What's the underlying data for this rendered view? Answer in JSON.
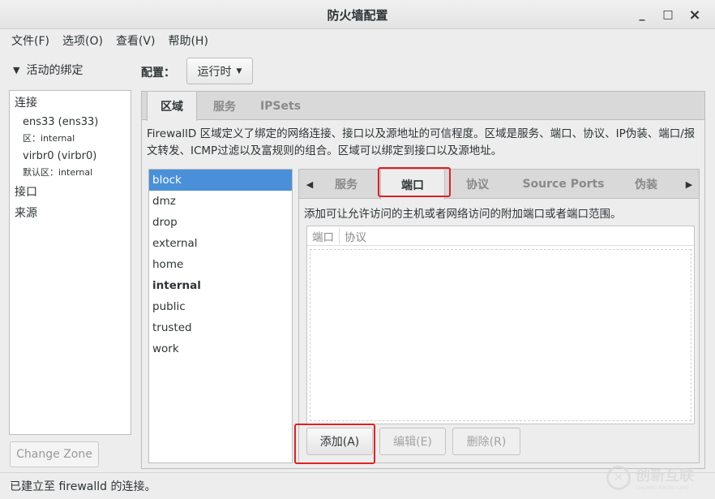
{
  "window": {
    "title": "防火墙配置",
    "minimize": "_",
    "maximize": "□",
    "close": "×"
  },
  "menu": [
    "文件(F)",
    "选项(O)",
    "查看(V)",
    "帮助(H)"
  ],
  "bindings": {
    "header": "活动的绑定",
    "connections_label": "连接",
    "connections": [
      {
        "name": "ens33 (ens33)",
        "zone": "区：internal"
      },
      {
        "name": "virbr0 (virbr0)",
        "zone": "默认区：internal"
      }
    ],
    "interfaces_label": "接口",
    "sources_label": "来源",
    "change_zone": "Change Zone"
  },
  "config": {
    "label": "配置：",
    "mode": "运行时"
  },
  "main_tabs": [
    "区域",
    "服务",
    "IPSets"
  ],
  "main_tab_active": 0,
  "zone_description": "FirewallD 区域定义了绑定的网络连接、接口以及源地址的可信程度。区域是服务、端口、协议、IP伪装、端口/报文转发、ICMP过滤以及富规则的组合。区域可以绑定到接口以及源地址。",
  "zones": [
    "block",
    "dmz",
    "drop",
    "external",
    "home",
    "internal",
    "public",
    "trusted",
    "work"
  ],
  "zone_selected": "block",
  "zone_default": "internal",
  "zone_tabs": [
    "服务",
    "端口",
    "协议",
    "Source Ports",
    "伪装"
  ],
  "zone_tab_active": 1,
  "ports": {
    "description": "添加可让允许访问的主机或者网络访问的附加端口或者端口范围。",
    "columns": [
      "端口",
      "协议"
    ],
    "rows": [],
    "add": "添加(A)",
    "edit": "编辑(E)",
    "remove": "删除(R)"
  },
  "status": "已建立至   firewalld 的连接。",
  "watermark": {
    "text": "创新互联",
    "sub": "CHUANG XIN HU LIAN"
  },
  "colors": {
    "selection": "#4a90d9",
    "highlight_box": "#e02020"
  }
}
